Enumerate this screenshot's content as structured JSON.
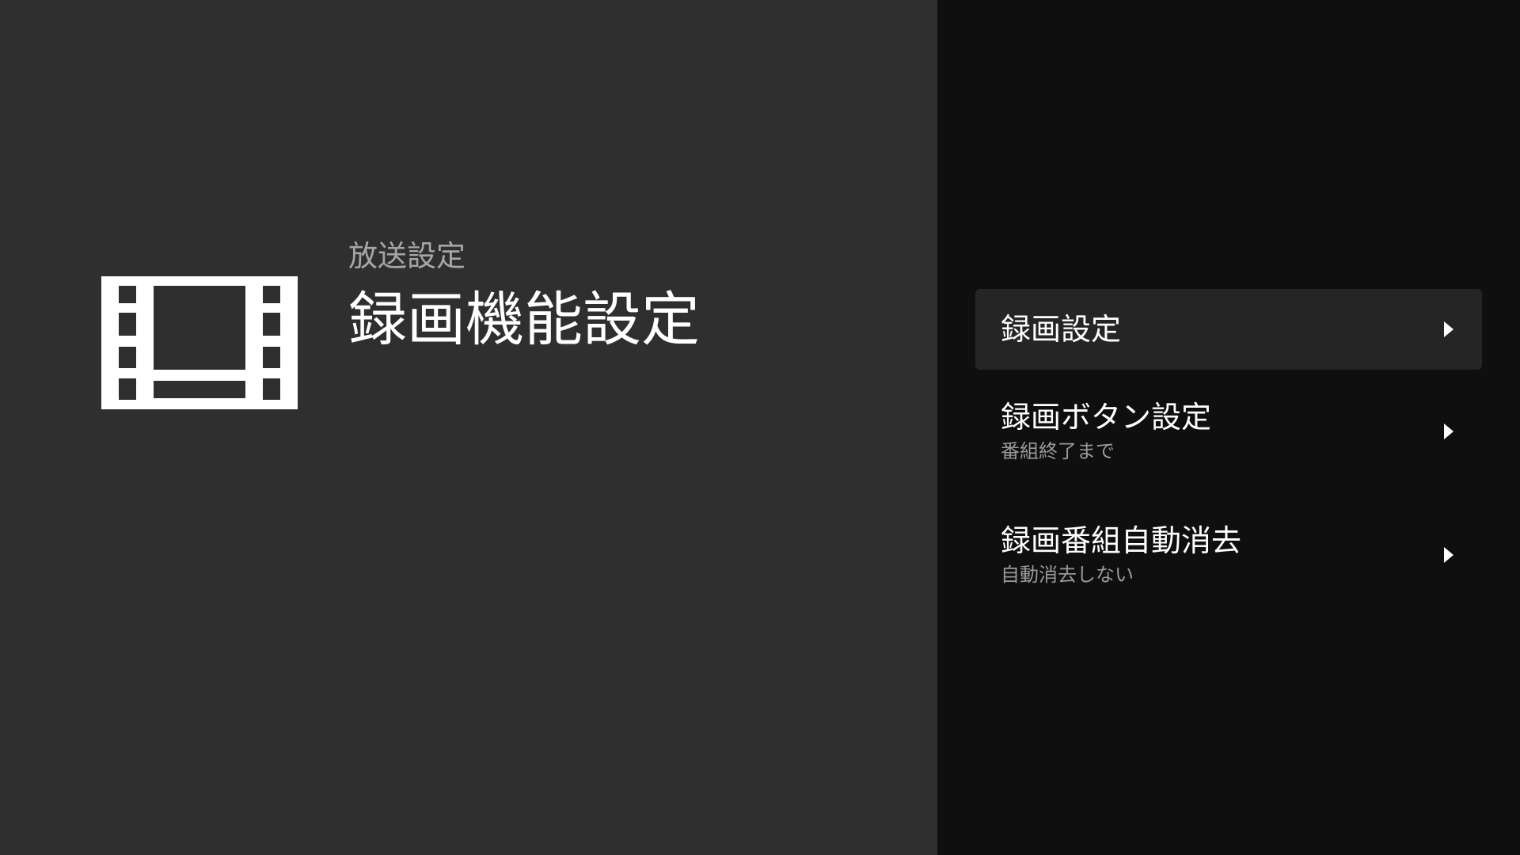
{
  "header": {
    "breadcrumb": "放送設定",
    "title": "録画機能設定",
    "icon": "movie-film-icon"
  },
  "menu": {
    "items": [
      {
        "label": "録画設定",
        "sub": "",
        "icon": "chevron-right-icon",
        "selected": true
      },
      {
        "label": "録画ボタン設定",
        "sub": "番組終了まで",
        "icon": "chevron-right-icon",
        "selected": false
      },
      {
        "label": "録画番組自動消去",
        "sub": "自動消去しない",
        "icon": "chevron-right-icon",
        "selected": false
      }
    ]
  },
  "colors": {
    "left_background": "#2f2f2f",
    "right_background": "#0f0f0f",
    "selected_item": "#252525",
    "text_primary": "#ffffff",
    "text_secondary": "#a6a6a6"
  }
}
